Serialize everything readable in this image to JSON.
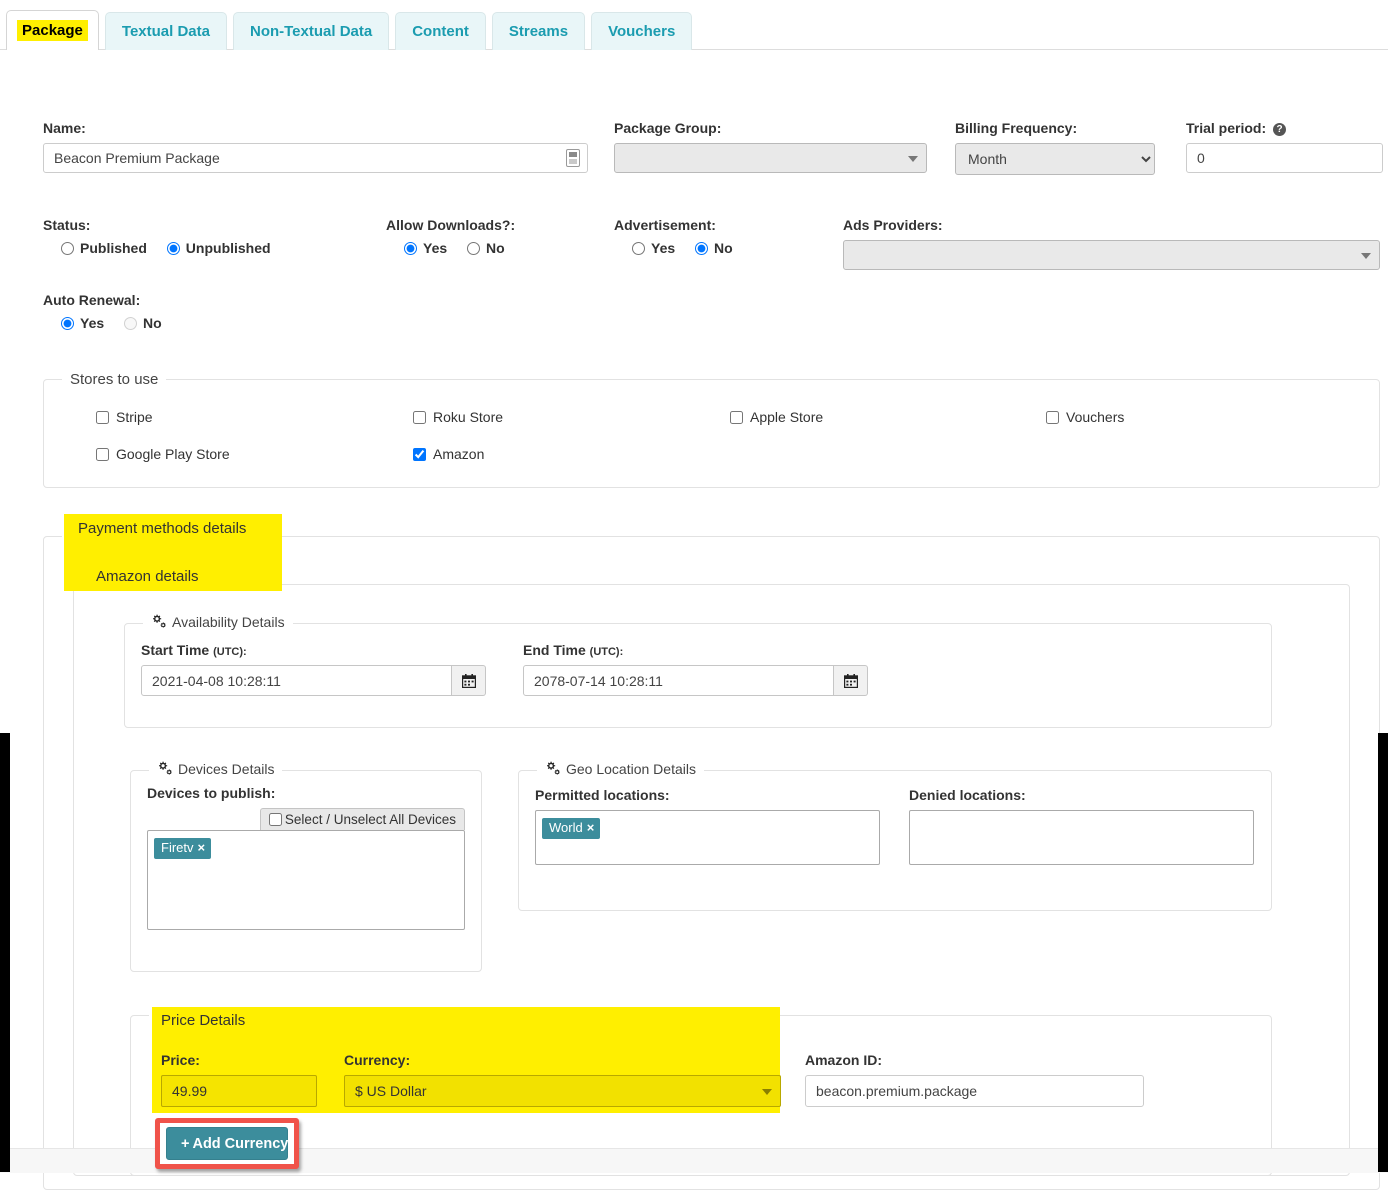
{
  "tabs": [
    {
      "label": "Package",
      "active": true
    },
    {
      "label": "Textual Data",
      "active": false
    },
    {
      "label": "Non-Textual Data",
      "active": false
    },
    {
      "label": "Content",
      "active": false
    },
    {
      "label": "Streams",
      "active": false
    },
    {
      "label": "Vouchers",
      "active": false
    }
  ],
  "form": {
    "name_label": "Name:",
    "name_value": "Beacon Premium Package",
    "package_group_label": "Package Group:",
    "package_group_value": "",
    "billing_frequency_label": "Billing Frequency:",
    "billing_frequency_value": "Month",
    "billing_frequency_options": [
      "Month"
    ],
    "trial_period_label": "Trial period:",
    "trial_period_value": "0",
    "status_label": "Status:",
    "status_published": "Published",
    "status_unpublished": "Unpublished",
    "status_selected": "Unpublished",
    "allow_downloads_label": "Allow Downloads?:",
    "allow_downloads_yes": "Yes",
    "allow_downloads_no": "No",
    "allow_downloads_selected": "Yes",
    "advertisement_label": "Advertisement:",
    "advertisement_yes": "Yes",
    "advertisement_no": "No",
    "advertisement_selected": "No",
    "ads_providers_label": "Ads Providers:",
    "ads_providers_value": "",
    "auto_renewal_label": "Auto Renewal:",
    "auto_renewal_yes": "Yes",
    "auto_renewal_no": "No",
    "auto_renewal_selected": "Yes"
  },
  "stores": {
    "legend": "Stores to use",
    "items": [
      {
        "label": "Stripe",
        "checked": false
      },
      {
        "label": "Roku Store",
        "checked": false
      },
      {
        "label": "Apple Store",
        "checked": false
      },
      {
        "label": "Vouchers",
        "checked": false
      },
      {
        "label": "Google Play Store",
        "checked": false
      },
      {
        "label": "Amazon",
        "checked": true
      }
    ]
  },
  "payment": {
    "legend": "Payment methods details",
    "amazon_legend": "Amazon details",
    "availability": {
      "legend": "Availability Details",
      "start_label": "Start Time",
      "start_sub": "(UTC):",
      "start_value": "2021-04-08 10:28:11",
      "end_label": "End Time",
      "end_sub": "(UTC):",
      "end_value": "2078-07-14 10:28:11"
    },
    "devices": {
      "legend": "Devices Details",
      "field_label": "Devices to publish:",
      "select_all_label": "Select / Unselect All Devices",
      "select_all_checked": false,
      "tokens": [
        "Firetv"
      ]
    },
    "geo": {
      "legend": "Geo Location Details",
      "permitted_label": "Permitted locations:",
      "permitted_tokens": [
        "World"
      ],
      "denied_label": "Denied locations:",
      "denied_tokens": []
    },
    "price": {
      "legend": "Price Details",
      "price_label": "Price:",
      "price_value": "49.99",
      "currency_label": "Currency:",
      "currency_value": "$ US Dollar",
      "add_currency_label": "Add Currency",
      "add_currency_plus": "+",
      "amazon_id_label": "Amazon ID:",
      "amazon_id_value": "beacon.premium.package"
    }
  },
  "colors": {
    "highlight": "#ffef00",
    "tab_active_text_bg": "#ffef00",
    "tab_inactive_bg": "#e9f6f8",
    "tab_inactive_text": "#1b9cb0",
    "teal_button": "#3c8d9c",
    "annotation_red": "#f0534a",
    "token_bg": "#3c8d9c"
  }
}
